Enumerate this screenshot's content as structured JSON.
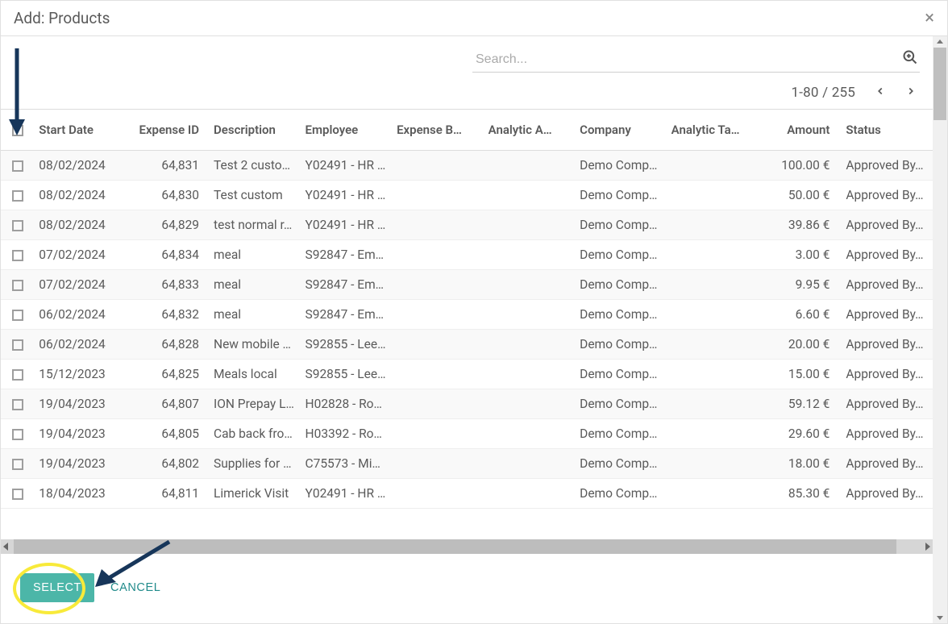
{
  "header": {
    "title": "Add: Products"
  },
  "search": {
    "placeholder": "Search..."
  },
  "pager": {
    "text": "1-80 / 255"
  },
  "columns": {
    "start_date": "Start Date",
    "expense_id": "Expense ID",
    "description": "Description",
    "employee": "Employee",
    "expense_b": "Expense B…",
    "analytic_a": "Analytic A…",
    "company": "Company",
    "analytic_tags": "Analytic Ta…",
    "amount": "Amount",
    "status": "Status"
  },
  "rows": [
    {
      "date": "08/02/2024",
      "id": "64,831",
      "desc": "Test 2 custo…",
      "emp": "Y02491 - HR …",
      "company": "Demo Company",
      "amount": "100.00 €",
      "status": "Approved By…"
    },
    {
      "date": "08/02/2024",
      "id": "64,830",
      "desc": "Test custom",
      "emp": "Y02491 - HR …",
      "company": "Demo Company",
      "amount": "50.00 €",
      "status": "Approved By…"
    },
    {
      "date": "08/02/2024",
      "id": "64,829",
      "desc": "test normal r…",
      "emp": "Y02491 - HR …",
      "company": "Demo Company",
      "amount": "39.86 €",
      "status": "Approved By…"
    },
    {
      "date": "07/02/2024",
      "id": "64,834",
      "desc": "meal",
      "emp": "S92847 - Em…",
      "company": "Demo Company",
      "amount": "3.00 €",
      "status": "Approved By…"
    },
    {
      "date": "07/02/2024",
      "id": "64,833",
      "desc": "meal",
      "emp": "S92847 - Em…",
      "company": "Demo Company",
      "amount": "9.95 €",
      "status": "Approved By…"
    },
    {
      "date": "06/02/2024",
      "id": "64,832",
      "desc": "meal",
      "emp": "S92847 - Em…",
      "company": "Demo Company",
      "amount": "6.60 €",
      "status": "Approved By…"
    },
    {
      "date": "06/02/2024",
      "id": "64,828",
      "desc": "New mobile …",
      "emp": "S92855 - Lee…",
      "company": "Demo Company",
      "amount": "20.00 €",
      "status": "Approved By…"
    },
    {
      "date": "15/12/2023",
      "id": "64,825",
      "desc": "Meals local",
      "emp": "S92855 - Lee…",
      "company": "Demo Company",
      "amount": "15.00 €",
      "status": "Approved By…"
    },
    {
      "date": "19/04/2023",
      "id": "64,807",
      "desc": "ION Prepay L…",
      "emp": "H02828 - Ro…",
      "company": "Demo Company",
      "amount": "59.12 €",
      "status": "Approved By…"
    },
    {
      "date": "19/04/2023",
      "id": "64,805",
      "desc": "Cab back fro…",
      "emp": "H03392 - Ro…",
      "company": "Demo Company",
      "amount": "29.60 €",
      "status": "Approved By…"
    },
    {
      "date": "19/04/2023",
      "id": "64,802",
      "desc": "Supplies for …",
      "emp": "C75573 - Mi…",
      "company": "Demo Company",
      "amount": "18.00 €",
      "status": "Approved By…"
    },
    {
      "date": "18/04/2023",
      "id": "64,811",
      "desc": "Limerick Visit",
      "emp": "Y02491 - HR …",
      "company": "Demo Company",
      "amount": "85.30 €",
      "status": "Approved By…"
    }
  ],
  "buttons": {
    "select": "SELECT",
    "cancel": "CANCEL"
  }
}
